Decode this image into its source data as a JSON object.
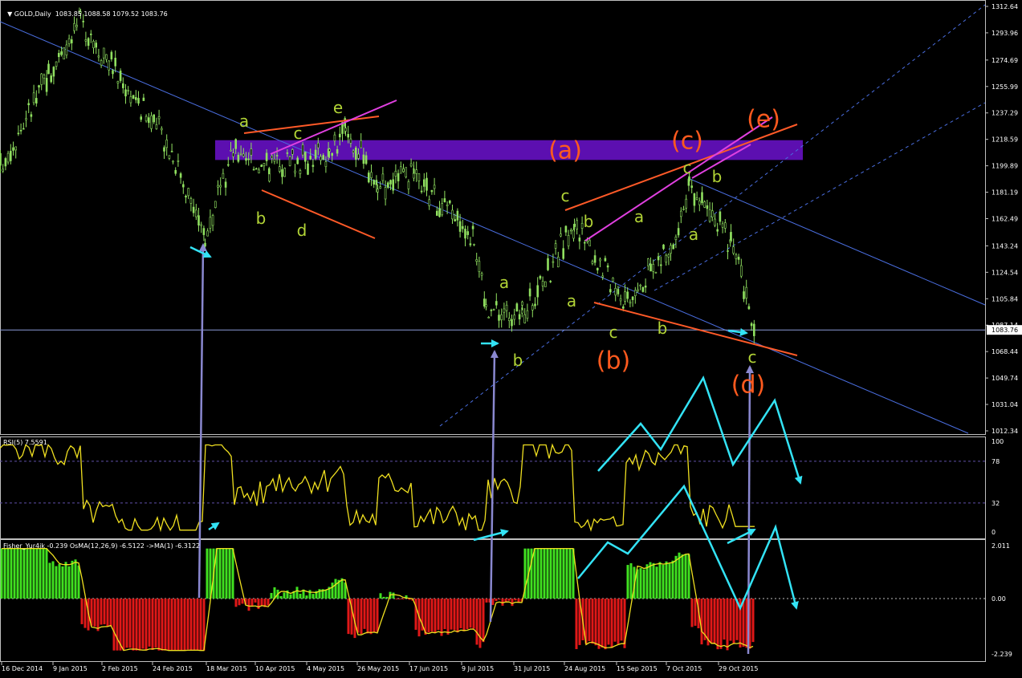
{
  "header": {
    "main_title": "GOLD,Daily",
    "main_ohlc": "1083.85 1088.58 1079.52 1083.76",
    "rsi_title": "RSI(5) 7.5591",
    "fisher_title": "Fisher_Yur4ik -0.239 OsMA(12,26,9) -6.5122 ->MA(1) -6.3122"
  },
  "current_price_label": "1083.76",
  "main_price_axis": [
    "1312.64",
    "1293.96",
    "1274.69",
    "1255.99",
    "1237.29",
    "1218.59",
    "1199.89",
    "1181.19",
    "1162.49",
    "1143.24",
    "1124.54",
    "1105.84",
    "1087.14",
    "1068.44",
    "1049.74",
    "1031.04",
    "1012.34"
  ],
  "rsi_axis": [
    "100",
    "78",
    "32",
    "0"
  ],
  "fisher_axis": [
    "2.011",
    "0.00",
    "-2.239"
  ],
  "date_axis": [
    "16 Dec 2014",
    "9 Jan 2015",
    "2 Feb 2015",
    "24 Feb 2015",
    "18 Mar 2015",
    "10 Apr 2015",
    "4 May 2015",
    "26 May 2015",
    "17 Jun 2015",
    "9 Jul 2015",
    "31 Jul 2015",
    "24 Aug 2015",
    "15 Sep 2015",
    "7 Oct 2015",
    "29 Oct 2015"
  ],
  "wave_labels_minor": [
    "a",
    "b",
    "c",
    "d",
    "e",
    "a",
    "b",
    "c",
    "a",
    "b",
    "c",
    "a",
    "b",
    "a",
    "b",
    "c",
    "b",
    "c"
  ],
  "wave_labels_major": [
    "(a)",
    "(b)",
    "(c)",
    "(d)",
    "(e)"
  ],
  "colors": {
    "background": "#000000",
    "candles": "#90e060",
    "trendline_blue": "#4a6ee0",
    "resistance_zone": "#5c0fb0",
    "wave_minor": "#b2d436",
    "wave_major": "#ff5a1e",
    "line_orange": "#ff5a28",
    "line_magenta": "#e040e0",
    "arrow_cyan": "#33e3f5",
    "arrow_purple": "#8a88d0",
    "rsi_line": "#f0e020",
    "histogram_positive": "#40e020",
    "histogram_negative": "#e01818"
  },
  "chart_data": {
    "type": "candlestick",
    "symbol": "GOLD",
    "timeframe": "Daily",
    "ylim": [
      1012.34,
      1312.64
    ],
    "last_close": 1083.76,
    "close_points": [
      {
        "x": "16 Dec 2014",
        "y": 1199
      },
      {
        "x": "9 Jan 2015",
        "y": 1265
      },
      {
        "x": "22 Jan 2015",
        "y": 1302
      },
      {
        "x": "2 Feb 2015",
        "y": 1270
      },
      {
        "x": "24 Feb 2015",
        "y": 1210
      },
      {
        "x": "17 Mar 2015",
        "y": 1148
      },
      {
        "x": "27 Mar 2015",
        "y": 1210
      },
      {
        "x": "10 Apr 2015",
        "y": 1200
      },
      {
        "x": "4 May 2015",
        "y": 1208
      },
      {
        "x": "15 May 2015",
        "y": 1226
      },
      {
        "x": "26 May 2015",
        "y": 1187
      },
      {
        "x": "17 Jun 2015",
        "y": 1190
      },
      {
        "x": "9 Jul 2015",
        "y": 1152
      },
      {
        "x": "20 Jul 2015",
        "y": 1098
      },
      {
        "x": "31 Jul 2015",
        "y": 1094
      },
      {
        "x": "24 Aug 2015",
        "y": 1158
      },
      {
        "x": "15 Sep 2015",
        "y": 1106
      },
      {
        "x": "7 Oct 2015",
        "y": 1140
      },
      {
        "x": "15 Oct 2015",
        "y": 1184
      },
      {
        "x": "29 Oct 2015",
        "y": 1148
      },
      {
        "x": "13 Nov 2015",
        "y": 1083.76
      }
    ],
    "resistance_zone": [
      1204,
      1218
    ],
    "rsi": {
      "name": "RSI(5)",
      "last": 7.5591,
      "levels": [
        78,
        32
      ],
      "ylim": [
        0,
        100
      ]
    },
    "fisher": {
      "name": "Fisher_Yur4ik",
      "value": -0.239,
      "osma": -6.5122,
      "ma": -6.3122,
      "ylim": [
        -2.239,
        2.011
      ]
    }
  }
}
